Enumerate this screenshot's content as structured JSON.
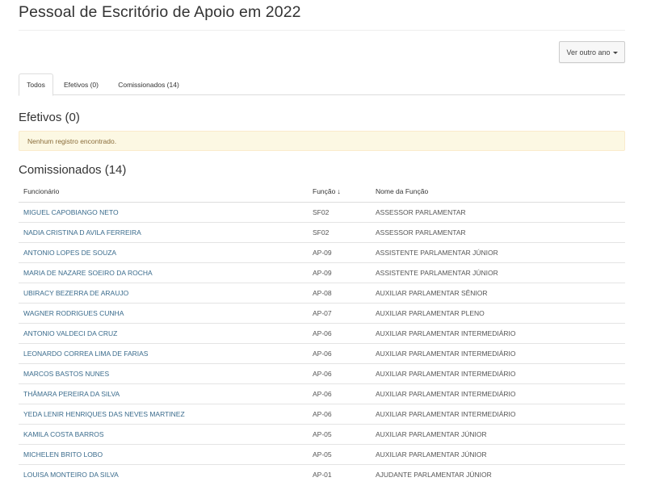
{
  "page": {
    "title": "Pessoal de Escritório de Apoio em 2022",
    "year_button": "Ver outro ano",
    "tabs": [
      {
        "label": "Todos",
        "active": true
      },
      {
        "label": "Efetivos (0)",
        "active": false
      },
      {
        "label": "Comissionados (14)",
        "active": false
      }
    ]
  },
  "efetivos": {
    "heading": "Efetivos (0)",
    "empty_message": "Nenhum registro encontrado."
  },
  "comissionados": {
    "heading": "Comissionados (14)",
    "columns": {
      "funcionario": "Funcionário",
      "funcao": "Função",
      "sort_icon": "sort-descending-icon",
      "nome_funcao": "Nome da Função"
    },
    "rows": [
      {
        "nome": "MIGUEL CAPOBIANGO NETO",
        "funcao": "SF02",
        "nome_funcao": "ASSESSOR PARLAMENTAR"
      },
      {
        "nome": "NADIA CRISTINA D AVILA FERREIRA",
        "funcao": "SF02",
        "nome_funcao": "ASSESSOR PARLAMENTAR"
      },
      {
        "nome": "ANTONIO LOPES DE SOUZA",
        "funcao": "AP-09",
        "nome_funcao": "ASSISTENTE PARLAMENTAR JÚNIOR"
      },
      {
        "nome": "MARIA DE NAZARE SOEIRO DA ROCHA",
        "funcao": "AP-09",
        "nome_funcao": "ASSISTENTE PARLAMENTAR JÚNIOR"
      },
      {
        "nome": "UBIRACY BEZERRA DE ARAUJO",
        "funcao": "AP-08",
        "nome_funcao": "AUXILIAR PARLAMENTAR SÊNIOR"
      },
      {
        "nome": "WAGNER RODRIGUES CUNHA",
        "funcao": "AP-07",
        "nome_funcao": "AUXILIAR PARLAMENTAR PLENO"
      },
      {
        "nome": "ANTONIO VALDECI DA CRUZ",
        "funcao": "AP-06",
        "nome_funcao": "AUXILIAR PARLAMENTAR INTERMEDIÁRIO"
      },
      {
        "nome": "LEONARDO CORREA LIMA DE FARIAS",
        "funcao": "AP-06",
        "nome_funcao": "AUXILIAR PARLAMENTAR INTERMEDIÁRIO"
      },
      {
        "nome": "MARCOS BASTOS NUNES",
        "funcao": "AP-06",
        "nome_funcao": "AUXILIAR PARLAMENTAR INTERMEDIÁRIO"
      },
      {
        "nome": "THÂMARA PEREIRA DA SILVA",
        "funcao": "AP-06",
        "nome_funcao": "AUXILIAR PARLAMENTAR INTERMEDIÁRIO"
      },
      {
        "nome": "YEDA LENIR HENRIQUES DAS NEVES MARTINEZ",
        "funcao": "AP-06",
        "nome_funcao": "AUXILIAR PARLAMENTAR INTERMEDIÁRIO"
      },
      {
        "nome": "KAMILA COSTA BARROS",
        "funcao": "AP-05",
        "nome_funcao": "AUXILIAR PARLAMENTAR JÚNIOR"
      },
      {
        "nome": "MICHELEN BRITO LOBO",
        "funcao": "AP-05",
        "nome_funcao": "AUXILIAR PARLAMENTAR JÚNIOR"
      },
      {
        "nome": "LOUISA MONTEIRO DA SILVA",
        "funcao": "AP-01",
        "nome_funcao": "AJUDANTE PARLAMENTAR JÚNIOR"
      }
    ]
  }
}
